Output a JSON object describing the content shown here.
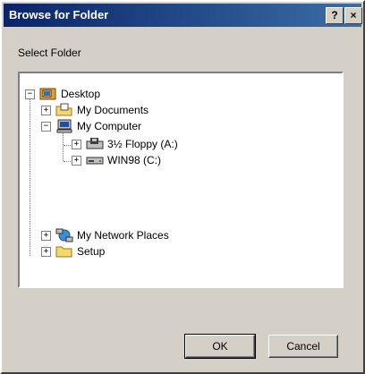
{
  "window": {
    "title": "Browse for Folder",
    "help_label": "?",
    "close_label": "×"
  },
  "prompt": "Select Folder",
  "tree": {
    "items": [
      {
        "label": "Desktop",
        "icon": "desktop-icon",
        "expander": "−"
      },
      {
        "label": "My Documents",
        "icon": "folder-documents-icon",
        "expander": "+"
      },
      {
        "label": "My Computer",
        "icon": "computer-icon",
        "expander": "−"
      },
      {
        "label": "3½ Floppy (A:)",
        "icon": "floppy-drive-icon",
        "expander": "+"
      },
      {
        "label": "WIN98 (C:)",
        "icon": "hard-drive-icon",
        "expander": "+"
      },
      {
        "label": "My Network Places",
        "icon": "network-places-icon",
        "expander": "+"
      },
      {
        "label": "Setup",
        "icon": "folder-icon",
        "expander": "+"
      }
    ]
  },
  "buttons": {
    "ok": "OK",
    "cancel": "Cancel"
  }
}
